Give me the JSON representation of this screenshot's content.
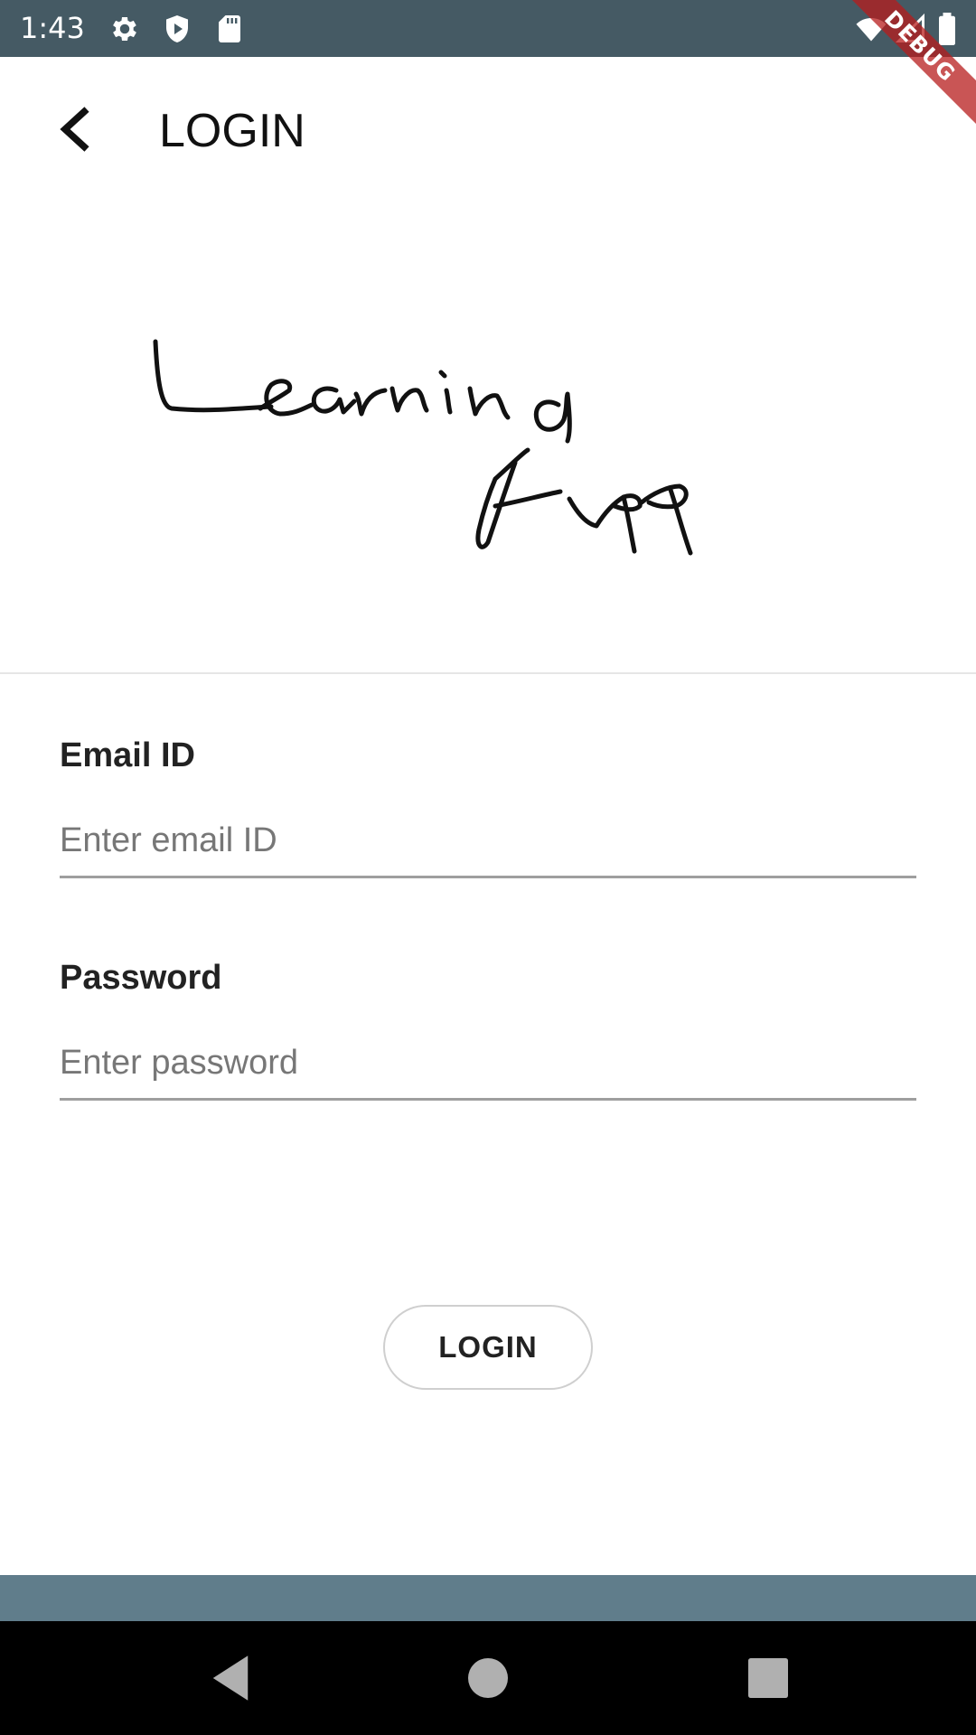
{
  "status_bar": {
    "time": "1:43",
    "left_icons": [
      "gear-icon",
      "shield-play-icon",
      "sd-card-icon"
    ],
    "right_icons": [
      "wifi-icon",
      "cell-signal-icon",
      "battery-icon"
    ],
    "background_color": "#455a64"
  },
  "debug_banner": {
    "label": "DEBUG",
    "color": "#b71c1c"
  },
  "app_bar": {
    "title": "LOGIN",
    "back_icon": "chevron-left-icon"
  },
  "logo": {
    "text": "Learning App",
    "style": "handwritten"
  },
  "form": {
    "email": {
      "label": "Email ID",
      "placeholder": "Enter email ID",
      "value": ""
    },
    "password": {
      "label": "Password",
      "placeholder": "Enter password",
      "value": ""
    },
    "login_button_label": "LOGIN"
  },
  "nav_bar": {
    "buttons": [
      "back-triangle-icon",
      "home-circle-icon",
      "recents-square-icon"
    ]
  },
  "colors": {
    "bottom_strip": "#607d8b",
    "nav_background": "#000000",
    "input_underline": "#9e9e9e"
  }
}
